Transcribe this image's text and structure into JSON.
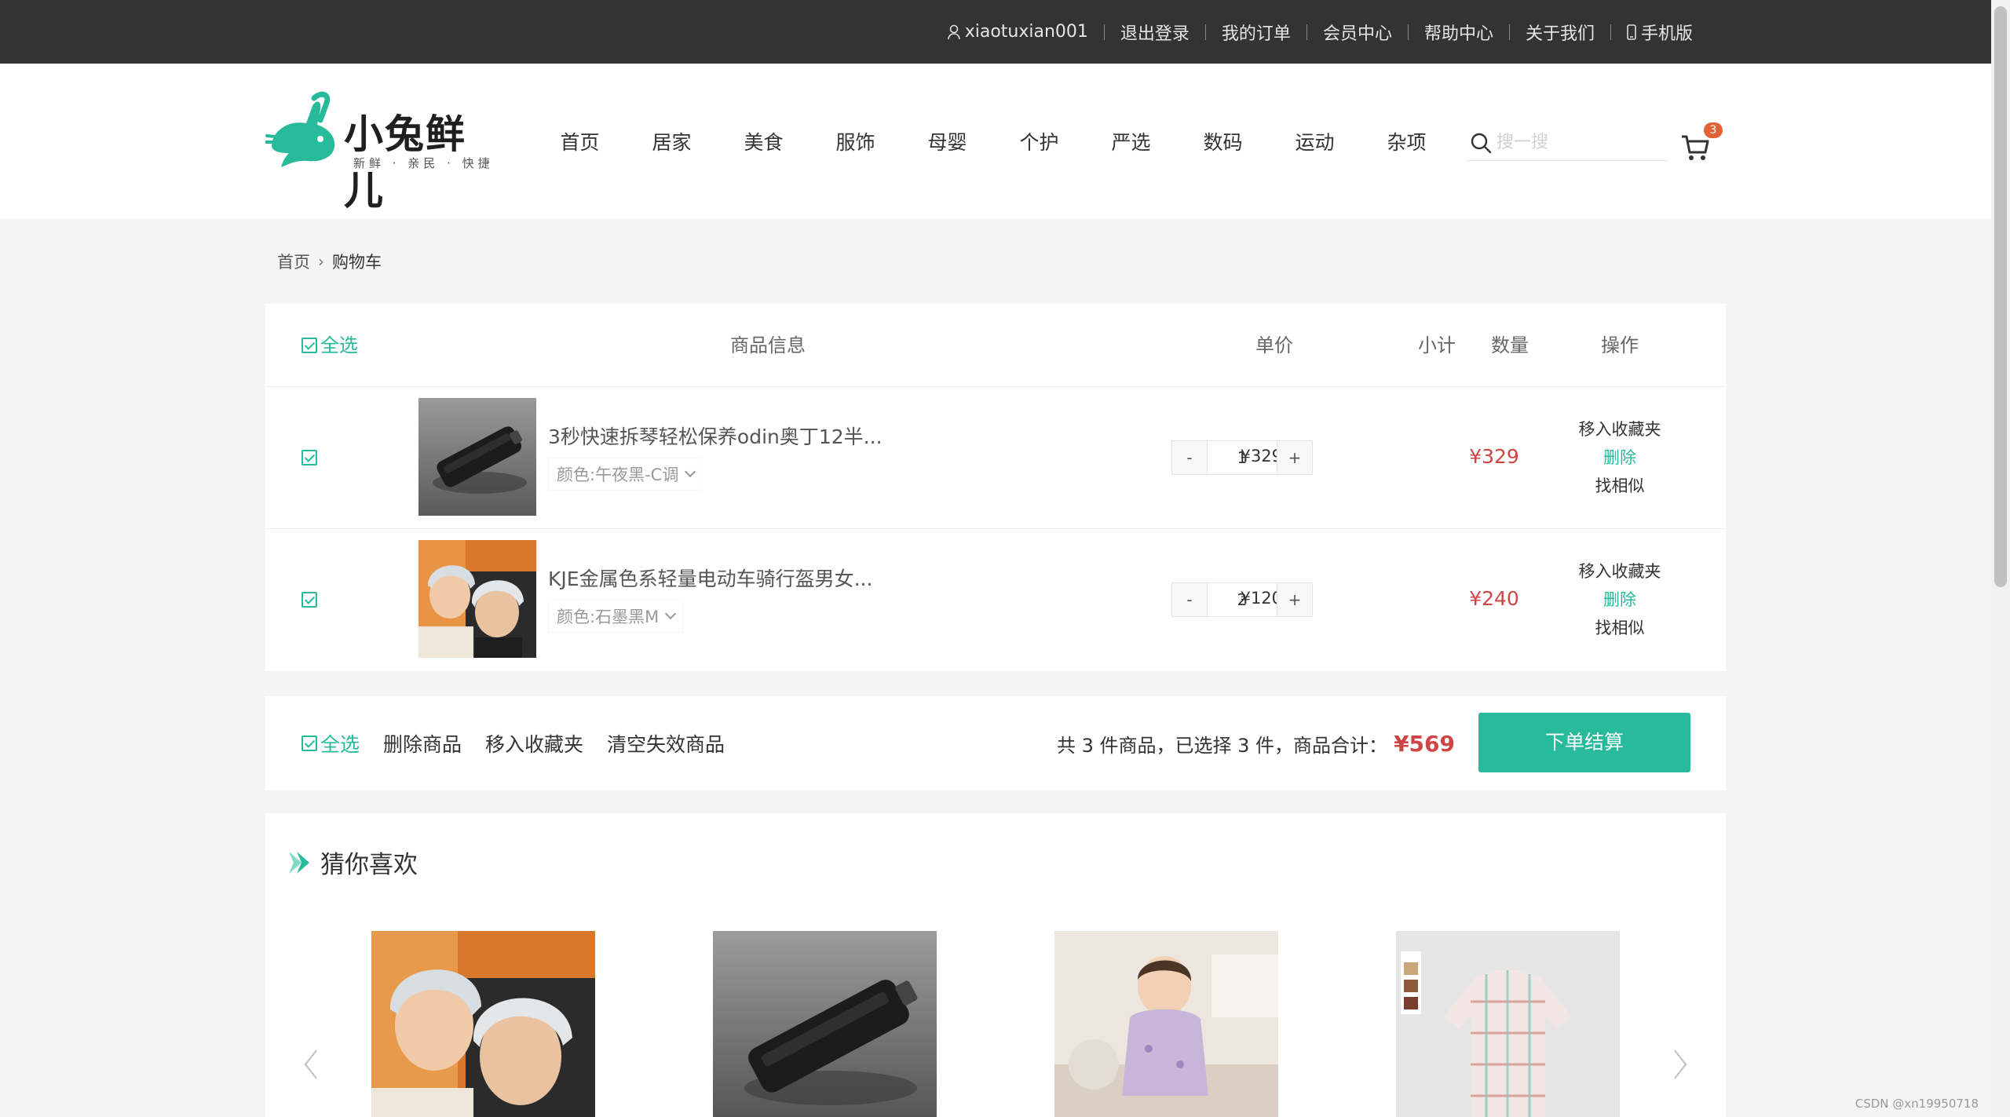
{
  "topbar": {
    "username": "xiaotuxian001",
    "links": [
      "退出登录",
      "我的订单",
      "会员中心",
      "帮助中心",
      "关于我们"
    ],
    "mobile": "手机版"
  },
  "logo": {
    "title": "小兔鲜儿",
    "subtitle": "新鲜 · 亲民 · 快捷"
  },
  "nav": [
    "首页",
    "居家",
    "美食",
    "服饰",
    "母婴",
    "个护",
    "严选",
    "数码",
    "运动",
    "杂项"
  ],
  "search": {
    "placeholder": "搜一搜"
  },
  "cart_badge": "3",
  "breadcrumb": {
    "home": "首页",
    "current": "购物车"
  },
  "table": {
    "select_all": "全选",
    "headers": [
      "商品信息",
      "单价",
      "数量",
      "小计",
      "操作"
    ]
  },
  "items": [
    {
      "name": "3秒快速拆琴轻松保养odin奥丁12半...",
      "attr": "颜色:午夜黑-C调",
      "price": "¥329.00",
      "qty": "1",
      "subtotal": "¥329",
      "ops": [
        "移入收藏夹",
        "删除",
        "找相似"
      ]
    },
    {
      "name": "KJE金属色系轻量电动车骑行盔男女...",
      "attr": "颜色:石墨黑M",
      "price": "¥120.00",
      "qty": "2",
      "subtotal": "¥240",
      "ops": [
        "移入收藏夹",
        "删除",
        "找相似"
      ]
    }
  ],
  "stepper": {
    "minus": "-",
    "plus": "+"
  },
  "action_bar": {
    "select_all": "全选",
    "delete": "删除商品",
    "move_fav": "移入收藏夹",
    "clear_invalid": "清空失效商品",
    "summary": "共 3 件商品，已选择 3 件，商品合计：",
    "total": "¥569",
    "checkout": "下单结算"
  },
  "recommend": {
    "title": "猜你喜欢"
  },
  "watermark": "CSDN @xn19950718",
  "colors": {
    "accent": "#27ba9b",
    "price": "#cf4444",
    "topbar": "#333333",
    "badge": "#e26237"
  }
}
